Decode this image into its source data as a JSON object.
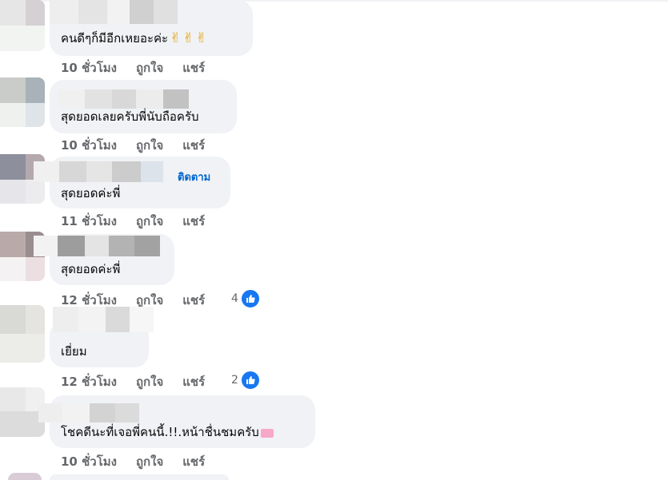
{
  "comments": [
    {
      "text": "คนดีๆก็มีอีกเหยอะค่ะ",
      "emoji": "✌",
      "time": "10 ชั่วโมง",
      "like": "ถูกใจ",
      "share": "แชร์"
    },
    {
      "text": "สุดยอดเลยครับพี่นับถือครับ",
      "time": "10 ชั่วโมง",
      "like": "ถูกใจ",
      "share": "แชร์"
    },
    {
      "text": "สุดยอดค่ะพี่",
      "follow": "ติดตาม",
      "time": "11 ชั่วโมง",
      "like": "ถูกใจ",
      "share": "แชร์"
    },
    {
      "text": "สุดยอดค่ะพี่",
      "time": "12 ชั่วโมง",
      "like": "ถูกใจ",
      "share": "แชร์",
      "reaction_count": "4"
    },
    {
      "text": "เยี่ยม",
      "time": "12 ชั่วโมง",
      "like": "ถูกใจ",
      "share": "แชร์",
      "reaction_count": "2"
    },
    {
      "text": "โชคดีนะที่เจอพี่คนนี้.!!.หน้าชื่นชมครับ",
      "time": "10 ชั่วโมง",
      "like": "ถูกใจ",
      "share": "แชร์"
    }
  ],
  "colors": {
    "bubble": "#f0f2f5",
    "meta": "#65676b",
    "link": "#0064d1",
    "like": "#1877f2"
  },
  "icons": {
    "like": "thumbs-up-icon",
    "victory": "victory-hand-icon",
    "envelope": "love-letter-icon"
  }
}
